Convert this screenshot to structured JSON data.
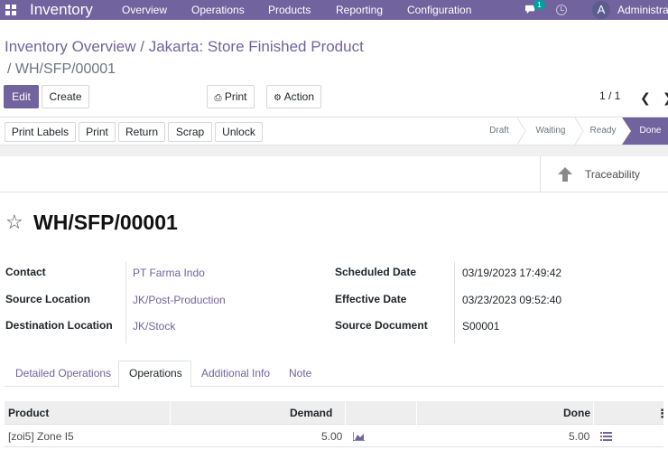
{
  "navbar": {
    "brand": "Inventory",
    "menus": [
      "Overview",
      "Operations",
      "Products",
      "Reporting",
      "Configuration"
    ],
    "chat_badge": "1",
    "avatar_letter": "A",
    "user_name": "Administrator"
  },
  "breadcrumb": {
    "parent": "Inventory Overview",
    "separator": "/",
    "middle": "Jakarta: Store Finished Product",
    "current": "/ WH/SFP/00001"
  },
  "control": {
    "edit": "Edit",
    "create": "Create",
    "print": "Print",
    "action": "Action",
    "pager": "1 / 1"
  },
  "statusbar": {
    "buttons": [
      "Print Labels",
      "Print",
      "Return",
      "Scrap",
      "Unlock"
    ],
    "stages": [
      "Draft",
      "Waiting",
      "Ready",
      "Done"
    ],
    "active_stage": "Done"
  },
  "smart_button": {
    "label": "Traceability"
  },
  "record": {
    "name": "WH/SFP/00001",
    "fields_left": [
      {
        "label": "Contact",
        "value": "PT Farma Indo"
      },
      {
        "label": "Source Location",
        "value": "JK/Post-Production"
      },
      {
        "label": "Destination Location",
        "value": "JK/Stock"
      }
    ],
    "fields_right": [
      {
        "label": "Scheduled Date",
        "value": "03/19/2023 17:49:42"
      },
      {
        "label": "Effective Date",
        "value": "03/23/2023 09:52:40"
      },
      {
        "label": "Source Document",
        "value": "S00001"
      }
    ]
  },
  "tabs": [
    "Detailed Operations",
    "Operations",
    "Additional Info",
    "Note"
  ],
  "active_tab": "Operations",
  "table": {
    "columns": [
      "Product",
      "Demand",
      "Done"
    ],
    "rows": [
      {
        "product": "[zoi5] Zone I5",
        "demand": "5.00",
        "done": "5.00"
      }
    ]
  },
  "colors": {
    "brand": "#71639e",
    "badge": "#00a09d"
  }
}
